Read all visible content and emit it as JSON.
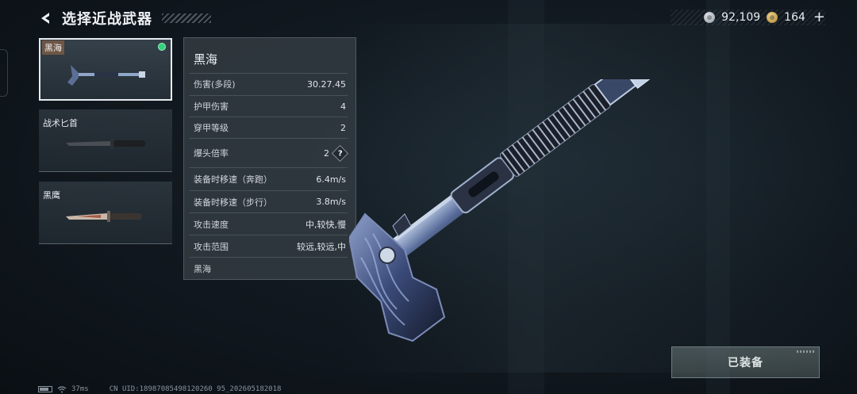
{
  "header": {
    "title": "选择近战武器"
  },
  "currency": [
    {
      "icon": "silver-coin-icon",
      "amount": "92,109"
    },
    {
      "icon": "gold-coin-icon",
      "amount": "164"
    }
  ],
  "weapons": [
    {
      "name": "黑海",
      "selected": true,
      "equipped": true
    },
    {
      "name": "战术匕首",
      "selected": false,
      "equipped": false
    },
    {
      "name": "黑鹰",
      "selected": false,
      "equipped": false
    }
  ],
  "stats": {
    "title": "黑海",
    "rows": [
      {
        "label": "伤害(多段)",
        "value": "30.27.45"
      },
      {
        "label": "护甲伤害",
        "value": "4"
      },
      {
        "label": "穿甲等级",
        "value": "2"
      },
      {
        "label": "爆头倍率",
        "value": "2",
        "help": "?"
      },
      {
        "label": "装备时移速（奔跑）",
        "value": "6.4m/s"
      },
      {
        "label": "装备时移速（步行）",
        "value": "3.8m/s"
      },
      {
        "label": "攻击速度",
        "value": "中,较快,慢"
      },
      {
        "label": "攻击范围",
        "value": "较远,较远,中"
      }
    ],
    "footer": "黑海"
  },
  "equip_button": {
    "label": "已装备"
  },
  "status_bar": {
    "ping": "37ms",
    "uid": "CN UID:18987085498120260 95_202605182018"
  },
  "colors": {
    "equipped_dot": "#34d07a",
    "selected_border": "#e6ebef"
  }
}
